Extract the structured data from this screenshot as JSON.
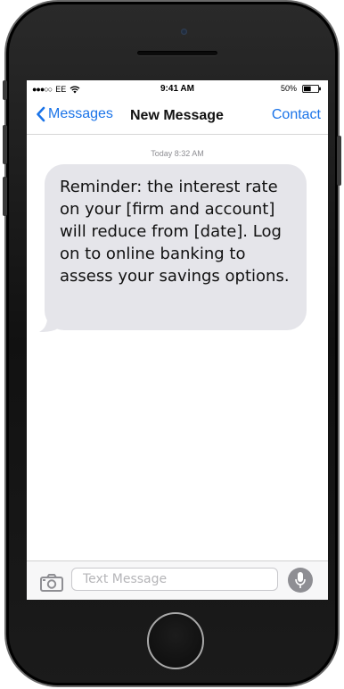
{
  "status_bar": {
    "signal": "●●●○○",
    "carrier": "EE",
    "time": "9:41 AM",
    "battery_percent": "50%",
    "battery_level": 0.5
  },
  "nav": {
    "back_label": "Messages",
    "title": "New Message",
    "contact_label": "Contact"
  },
  "conversation": {
    "timestamp": "Today 8:32 AM",
    "messages": [
      {
        "direction": "incoming",
        "text": "Reminder: the interest rate on your [firm and account] will reduce from [date]. Log on to online banking to assess your savings options."
      }
    ]
  },
  "compose": {
    "placeholder": "Text Message",
    "value": ""
  },
  "colors": {
    "accent": "#1a73e8",
    "incoming_bubble": "#e5e5ea",
    "mic_button": "#8e8e93"
  },
  "icons": {
    "back": "chevron-left-icon",
    "camera": "camera-icon",
    "mic": "microphone-icon",
    "wifi": "wifi-icon",
    "battery": "battery-icon"
  }
}
